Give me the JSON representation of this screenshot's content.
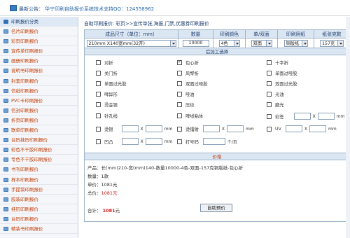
{
  "topbar": {
    "notice_label": "最新公告：",
    "notice_text": "华宁印刷自助报价系统技术支持QQ：124558962"
  },
  "sidebar": {
    "items": [
      {
        "label": "印刷报价分类",
        "active": true
      },
      {
        "label": "名片印刷报价"
      },
      {
        "label": "彩页印刷报价"
      },
      {
        "label": "宣传单印刷报价"
      },
      {
        "label": "画册印刷报价"
      },
      {
        "label": "说明书印刷报价"
      },
      {
        "label": "封套印刷报价"
      },
      {
        "label": "信纸印刷报价"
      },
      {
        "label": "PVC卡印刷报价"
      },
      {
        "label": "信封印刷报价"
      },
      {
        "label": "折页印刷报价"
      },
      {
        "label": "联单印刷报价"
      },
      {
        "label": "台历挂历印刷报价"
      },
      {
        "label": "彩色不干胶印刷报价"
      },
      {
        "label": "专色不干胶印刷报价"
      },
      {
        "label": "书刊印刷报价"
      },
      {
        "label": "样本印刷报价"
      },
      {
        "label": "手提袋印刷报价"
      },
      {
        "label": "胶装印刷报价"
      },
      {
        "label": "挂历印刷报价"
      },
      {
        "label": "台历印刷报价"
      },
      {
        "label": "精装书印刷报价"
      }
    ]
  },
  "main": {
    "breadcrumb": "自助印刷报价: 彩页>>宣传单张,海报,门票,优惠券印刷报价",
    "headers": [
      "成品尺寸（单位：mm）",
      "数量",
      "印刷颜色",
      "单/双面",
      "印刷用纸",
      "纸张克数"
    ],
    "values": {
      "size": "210mm X140宽mm(32开)",
      "quantity": "10000",
      "color": "4色",
      "sides": "双面",
      "paper": "铜版纸",
      "weight": "157克"
    },
    "post_process_title": "后加工选择",
    "options": {
      "o1": "对折",
      "o2": "包心折",
      "o3": "十字折",
      "o4": "关门折",
      "o5": "风琴折",
      "o6": "单面过哑胶",
      "o7": "单面过光胶",
      "o8": "双面过哑胶",
      "o9": "双面过光胶",
      "o10": "啤异形",
      "o11": "哑油",
      "o12": "光油",
      "o13": "烫金银",
      "o14": "压纹",
      "o15": "磨光",
      "o16": "针孔线",
      "o17": "啤线粘体",
      "o18": "彩签",
      "o19": "烫银",
      "o20": "烫镭射",
      "o21": "UV",
      "o22": "凹凸",
      "o23": "打号码",
      "o24": "个/页"
    },
    "unit_x": "X",
    "unit_mm": "mm",
    "price_title": "价格",
    "result": {
      "product_label": "产品：",
      "product_text": "长(mm)210-宽(mm)140-数量10000-4色-双面-157克铜版纸-包心折",
      "qty_label": "数量：",
      "qty_value": "1款",
      "unit_label": "单价：",
      "unit_value": "1081元",
      "total_label": "总价：",
      "total_value": "1081元",
      "sum_label": "合计：",
      "sum_value": "1081",
      "sum_unit": "元"
    },
    "calc_button": "自助预价"
  }
}
